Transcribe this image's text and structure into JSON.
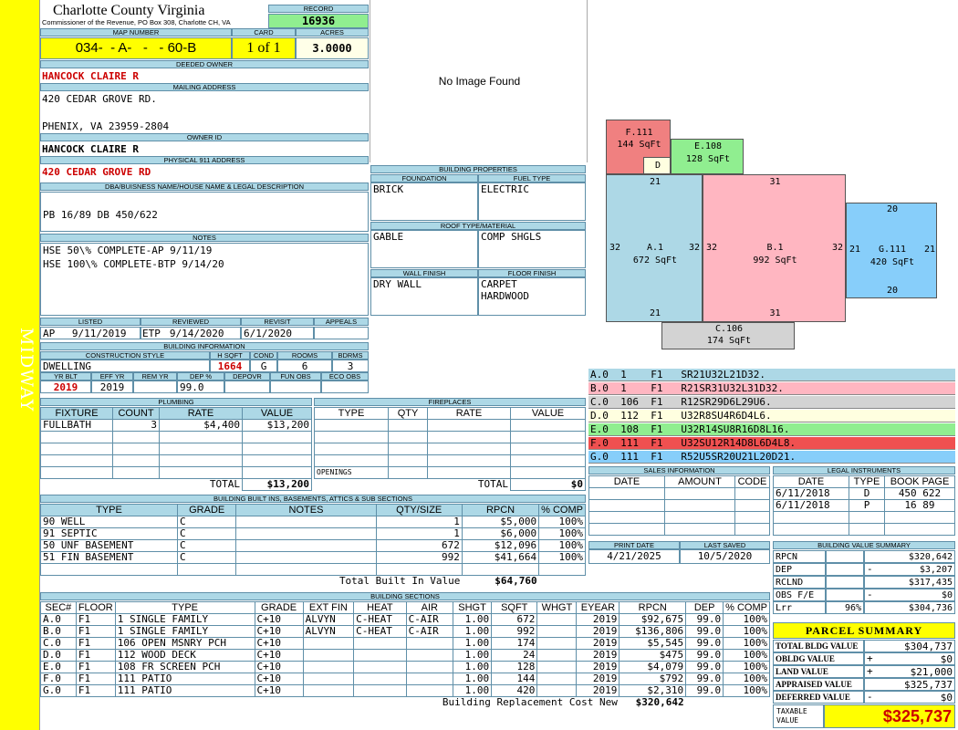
{
  "sidebar": {
    "label": "MIDWAY",
    "color": "#ffff00"
  },
  "header": {
    "county": "Charlotte County Virginia",
    "subtitle": "Commissioner of the Revenue, PO Box 308, Charlotte CH, VA",
    "record_label": "RECORD",
    "record": "16936",
    "map_number_label": "MAP NUMBER",
    "map_number": "034-  - A-   -   - 60-B",
    "card_label": "CARD",
    "card": "1 of 1",
    "acres_label": "ACRES",
    "acres": "3.0000"
  },
  "owner": {
    "deeded_owner_label": "DEEDED OWNER",
    "deeded_owner": "HANCOCK CLAIRE R",
    "mailing_label": "MAILING ADDRESS",
    "mailing_line1": "420 CEDAR GROVE RD.",
    "mailing_line2": "",
    "mailing_line3": "PHENIX, VA 23959-2804",
    "owner_id_label": "OWNER ID",
    "owner_id": "HANCOCK CLAIRE R",
    "physical_label": "PHYSICAL 911 ADDRESS",
    "physical": "420 CEDAR GROVE RD"
  },
  "legal": {
    "label": "DBA/BUISNESS NAME/HOUSE NAME & LEGAL DESCRIPTION",
    "text": "PB 16/89 DB 450/622"
  },
  "notes": {
    "label": "NOTES",
    "line1": "HSE 50\\% COMPLETE-AP 9/11/19",
    "line2": "HSE 100\\% COMPLETE-BTP 9/14/20"
  },
  "photo": {
    "text": "No Image Found"
  },
  "listing": {
    "listed_label": "LISTED",
    "listed_by": "AP",
    "listed_date": "9/11/2019",
    "reviewed_label": "REVIEWED",
    "reviewed_by": "ETP",
    "reviewed_date": "9/14/2020",
    "revisit_label": "REVISIT",
    "revisit": "6/1/2020",
    "appeals_label": "APPEALS",
    "appeals": ""
  },
  "building_info": {
    "label": "BUILDING INFORMATION",
    "construction_label": "CONSTRUCTION STYLE",
    "construction": "DWELLING",
    "hsqft_label": "H SQFT",
    "hsqft": "1664",
    "cond_label": "COND",
    "cond": "G",
    "rooms_label": "ROOMS",
    "rooms": "6",
    "bdrms_label": "BDRMS",
    "bdrms": "3",
    "yrblt_label": "YR BLT",
    "yrblt": "2019",
    "effyr_label": "EFF YR",
    "effyr": "2019",
    "remyr_label": "REM YR",
    "remyr": "",
    "dep_label": "DEP %",
    "dep": "99.0",
    "depovr_label": "DEPOVR",
    "depovr": "",
    "funobs_label": "FUN OBS",
    "funobs": "",
    "ecoobs_label": "ECO OBS",
    "ecoobs": ""
  },
  "building_props": {
    "label": "BUILDING PROPERTIES",
    "foundation_label": "FOUNDATION",
    "foundation": "BRICK",
    "fuel_label": "FUEL TYPE",
    "fuel": "ELECTRIC",
    "roof_label": "ROOF TYPE/MATERIAL",
    "roof_type": "GABLE",
    "roof_material": "COMP SHGLS",
    "wall_label": "WALL FINISH",
    "wall": "DRY WALL",
    "floor_label": "FLOOR FINISH",
    "floor1": "CARPET",
    "floor2": "HARDWOOD"
  },
  "plumbing": {
    "label": "PLUMBING",
    "headers": [
      "FIXTURE",
      "COUNT",
      "RATE",
      "VALUE"
    ],
    "rows": [
      [
        "FULLBATH",
        "3",
        "$4,400",
        "$13,200"
      ]
    ],
    "total_label": "TOTAL",
    "total": "$13,200"
  },
  "fireplaces": {
    "label": "FIREPLACES",
    "headers": [
      "TYPE",
      "QTY",
      "RATE",
      "VALUE"
    ],
    "openings_label": "OPENINGS",
    "total_label": "TOTAL",
    "total": "$0"
  },
  "builtins": {
    "label": "BUILDING BUILT INS, BASEMENTS, ATTICS & SUB SECTIONS",
    "headers": [
      "TYPE",
      "GRADE",
      "NOTES",
      "QTY/SIZE",
      "RPCN",
      "% COMP"
    ],
    "rows": [
      [
        "90 WELL",
        "C",
        "",
        "1",
        "$5,000",
        "100%"
      ],
      [
        "91 SEPTIC",
        "C",
        "",
        "1",
        "$6,000",
        "100%"
      ],
      [
        "50 UNF BASEMENT",
        "C",
        "",
        "672",
        "$12,096",
        "100%"
      ],
      [
        "51 FIN BASEMENT",
        "C",
        "",
        "992",
        "$41,664",
        "100%"
      ]
    ],
    "total_label": "Total Built In Value",
    "total": "$64,760"
  },
  "sections": {
    "label": "BUILDING SECTIONS",
    "headers": [
      "SEC#",
      "FLOOR",
      "TYPE",
      "GRADE",
      "EXT FIN",
      "HEAT",
      "AIR",
      "SHGT",
      "SQFT",
      "WHGT",
      "EYEAR",
      "RPCN",
      "DEP",
      "% COMP"
    ],
    "rows": [
      [
        "A.0",
        "F1",
        "1 SINGLE FAMILY",
        "C+10",
        "ALVYN",
        "C-HEAT",
        "C-AIR",
        "1.00",
        "672",
        "",
        "2019",
        "$92,675",
        "99.0",
        "100%"
      ],
      [
        "B.0",
        "F1",
        "1 SINGLE FAMILY",
        "C+10",
        "ALVYN",
        "C-HEAT",
        "C-AIR",
        "1.00",
        "992",
        "",
        "2019",
        "$136,806",
        "99.0",
        "100%"
      ],
      [
        "C.0",
        "F1",
        "106 OPEN MSNRY PCH",
        "C+10",
        "",
        "",
        "",
        "1.00",
        "174",
        "",
        "2019",
        "$5,545",
        "99.0",
        "100%"
      ],
      [
        "D.0",
        "F1",
        "112 WOOD DECK",
        "C+10",
        "",
        "",
        "",
        "1.00",
        "24",
        "",
        "2019",
        "$475",
        "99.0",
        "100%"
      ],
      [
        "E.0",
        "F1",
        "108 FR SCREEN PCH",
        "C+10",
        "",
        "",
        "",
        "1.00",
        "128",
        "",
        "2019",
        "$4,079",
        "99.0",
        "100%"
      ],
      [
        "F.0",
        "F1",
        "111 PATIO",
        "C+10",
        "",
        "",
        "",
        "1.00",
        "144",
        "",
        "2019",
        "$792",
        "99.0",
        "100%"
      ],
      [
        "G.0",
        "F1",
        "111 PATIO",
        "C+10",
        "",
        "",
        "",
        "1.00",
        "420",
        "",
        "2019",
        "$2,310",
        "99.0",
        "100%"
      ]
    ],
    "total_label": "Building Replacement Cost New",
    "total": "$320,642"
  },
  "sketch": {
    "areas": [
      {
        "id": "F",
        "label": "F.111",
        "sqft": "144 SqFt",
        "color": "#f08080"
      },
      {
        "id": "E",
        "label": "E.108",
        "sqft": "128 SqFt",
        "color": "#90ee90"
      },
      {
        "id": "D",
        "label": "D",
        "sqft": "",
        "color": "#ffffe0"
      },
      {
        "id": "A",
        "label": "A.1",
        "sqft": "672 SqFt",
        "color": "#add8e6"
      },
      {
        "id": "B",
        "label": "B.1",
        "sqft": "992 SqFt",
        "color": "#ffb6c1"
      },
      {
        "id": "G",
        "label": "G.111",
        "sqft": "420 SqFt",
        "color": "#87cefa"
      },
      {
        "id": "C",
        "label": "C.106",
        "sqft": "174 SqFt",
        "color": "#d3d3d3"
      }
    ],
    "dims": {
      "a_top": "21",
      "a_left": "32",
      "a_right": "32",
      "a_bottom": "21",
      "b_top": "31",
      "b_left": "32",
      "b_right": "32",
      "b_bottom": "31",
      "g_top": "20",
      "g_left": "21",
      "g_right": "21",
      "g_bottom": "20"
    }
  },
  "codes": [
    {
      "text": "A.0  1    F1   SR21U32L21D32.",
      "color": "#add8e6"
    },
    {
      "text": "B.0  1    F1   R21SR31U32L31D32.",
      "color": "#ffb6c1"
    },
    {
      "text": "C.0  106  F1   R12SR29D6L29U6.",
      "color": "#d3d3d3"
    },
    {
      "text": "D.0  112  F1   U32R8SU4R6D4L6.",
      "color": "#ffffe0"
    },
    {
      "text": "E.0  108  F1   U32R14SU8R16D8L16.",
      "color": "#90ee90"
    },
    {
      "text": "F.0  111  F1   U32SU12R14D8L6D4L8.",
      "color": "#f05050"
    },
    {
      "text": "G.0  111  F1   R52U5SR20U21L20D21.",
      "color": "#87cefa"
    }
  ],
  "sales": {
    "label": "SALES INFORMATION",
    "headers": [
      "DATE",
      "AMOUNT",
      "CODE"
    ]
  },
  "legal_instruments": {
    "label": "LEGAL INSTRUMENTS",
    "headers": [
      "DATE",
      "TYPE",
      "BOOK PAGE"
    ],
    "rows": [
      [
        "6/11/2018",
        "D",
        "450 622"
      ],
      [
        "6/11/2018",
        "P",
        "16 89"
      ]
    ]
  },
  "print": {
    "print_label": "PRINT DATE",
    "print_date": "4/21/2025",
    "saved_label": "LAST SAVED",
    "saved_date": "10/5/2020"
  },
  "value_summary": {
    "label": "BUILDING VALUE SUMMARY",
    "rows": [
      {
        "name": "RPCN",
        "sign": "",
        "pct": "",
        "value": "$320,642"
      },
      {
        "name": "DEP",
        "sign": "-",
        "pct": "",
        "value": "$3,207"
      },
      {
        "name": "RCLND",
        "sign": "",
        "pct": "",
        "value": "$317,435"
      },
      {
        "name": "OBS F/E",
        "sign": "-",
        "pct": "",
        "value": "$0"
      },
      {
        "name": "Lrr",
        "sign": "",
        "pct": "96%",
        "value": "$304,736"
      }
    ]
  },
  "parcel": {
    "label": "PARCEL SUMMARY",
    "rows": [
      {
        "name": "TOTAL BLDG VALUE",
        "sign": "",
        "value": "$304,737"
      },
      {
        "name": "OBLDG VALUE",
        "sign": "+",
        "value": "$0"
      },
      {
        "name": "LAND VALUE",
        "sign": "+",
        "value": "$21,000"
      },
      {
        "name": "APPRAISED VALUE",
        "sign": "",
        "value": "$325,737"
      },
      {
        "name": "DEFERRED VALUE",
        "sign": "-",
        "value": "$0"
      }
    ],
    "taxable_label": "TAXABLE VALUE",
    "taxable": "$325,737"
  }
}
